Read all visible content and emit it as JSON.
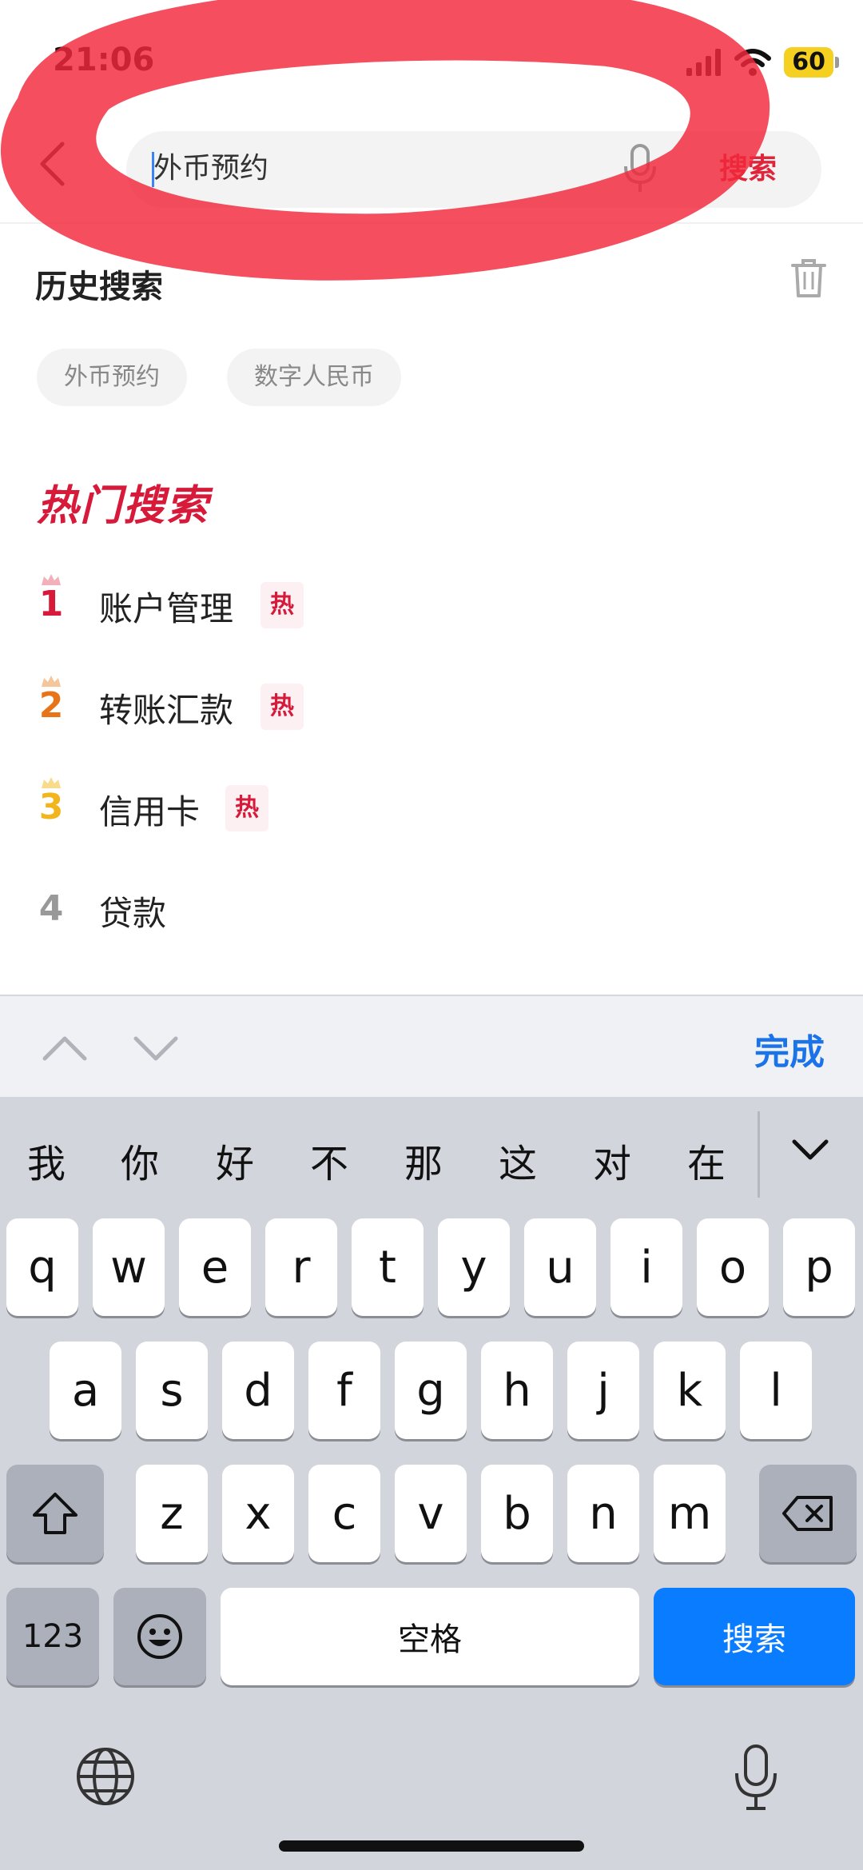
{
  "status_bar": {
    "time": "21:06",
    "battery": "60"
  },
  "search": {
    "placeholder": "外币预约",
    "submit_label": "搜索"
  },
  "history": {
    "title": "历史搜索",
    "items": [
      "外币预约",
      "数字人民币"
    ]
  },
  "hot": {
    "title": "热门搜索",
    "badge": "热",
    "items": [
      {
        "rank": "1",
        "label": "账户管理",
        "color": "#d7193a",
        "crown": "#f2b1b8",
        "hot": true
      },
      {
        "rank": "2",
        "label": "转账汇款",
        "color": "#e8741a",
        "crown": "#f6c69a",
        "hot": true
      },
      {
        "rank": "3",
        "label": "信用卡",
        "color": "#f2b51c",
        "crown": "#f8dc8c",
        "hot": true
      },
      {
        "rank": "4",
        "label": "贷款",
        "color": "#999999",
        "crown": "",
        "hot": false
      }
    ]
  },
  "keyboard": {
    "done_label": "完成",
    "candidates": [
      "我",
      "你",
      "好",
      "不",
      "那",
      "这",
      "对",
      "在"
    ],
    "row1": [
      "q",
      "w",
      "e",
      "r",
      "t",
      "y",
      "u",
      "i",
      "o",
      "p"
    ],
    "row2": [
      "a",
      "s",
      "d",
      "f",
      "g",
      "h",
      "j",
      "k",
      "l"
    ],
    "row3": [
      "z",
      "x",
      "c",
      "v",
      "b",
      "n",
      "m"
    ],
    "numbers_label": "123",
    "space_label": "空格",
    "return_label": "搜索"
  },
  "colors": {
    "accent_red": "#e0243a",
    "keyboard_blue": "#0a7cff",
    "done_blue": "#1a73e8",
    "annotation_red": "#f2283c"
  }
}
